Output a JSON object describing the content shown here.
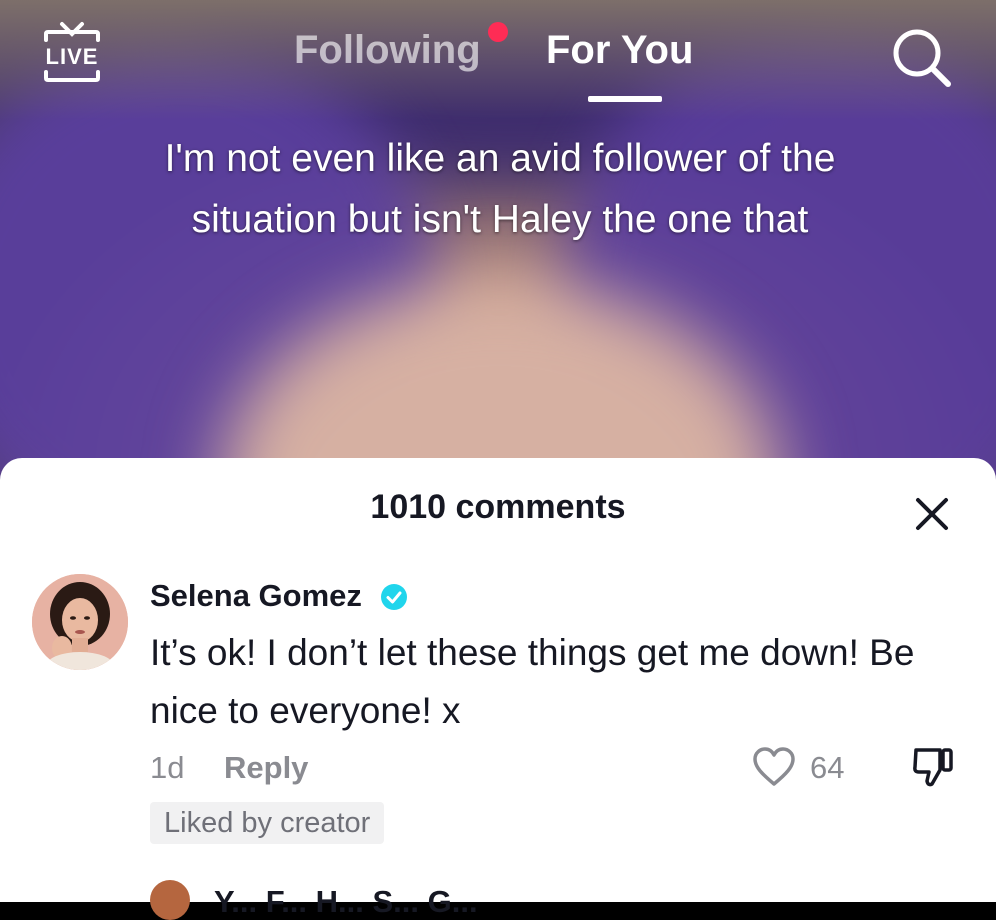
{
  "header": {
    "live_label": "LIVE",
    "tab_following": "Following",
    "tab_foryou": "For You"
  },
  "video": {
    "caption": "I'm not even like an avid follower of the situation but isn't Haley the one that"
  },
  "comments": {
    "count_label": "1010 comments",
    "items": [
      {
        "username": "Selena Gomez",
        "verified": true,
        "text": "It’s ok! I don’t let these things get me down! Be nice to everyone! x",
        "time": "1d",
        "reply_label": "Reply",
        "likes": "64",
        "badge": "Liked by creator"
      }
    ],
    "next_preview": "Y... F... H... S... G..."
  },
  "colors": {
    "accent": "#fe2c55",
    "verified": "#20d5ec",
    "text_primary": "#161823",
    "text_secondary": "#8a8b91"
  }
}
